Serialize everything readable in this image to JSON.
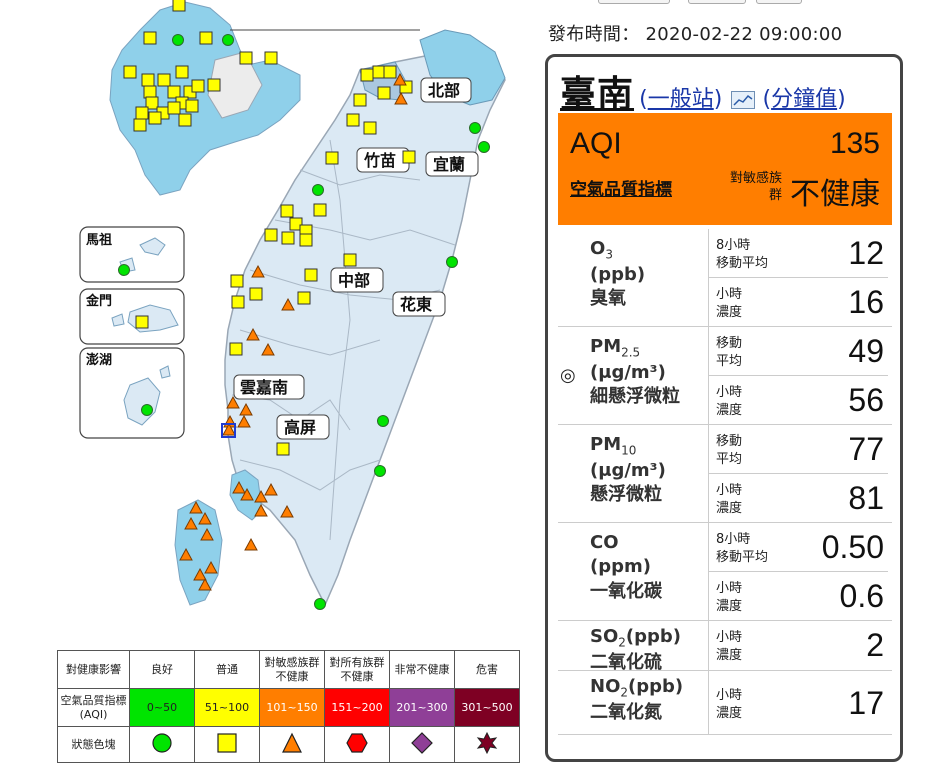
{
  "published": {
    "label": "發布時間：",
    "value": "2020-02-22 09:00:00"
  },
  "map": {
    "regions": [
      "北部",
      "竹苗",
      "宜蘭",
      "中部",
      "花東",
      "雲嘉南",
      "高屏"
    ],
    "insets": [
      "馬祖",
      "金門",
      "澎湖"
    ],
    "colors": {
      "land": "#dbe9f4",
      "county": "#aac8e0",
      "highlight": "#8fd0ea",
      "outline": "#9aa7b5"
    }
  },
  "legend": {
    "header": [
      "對健康影響",
      "良好",
      "普通",
      "對敏感族群不健康",
      "對所有族群不健康",
      "非常不健康",
      "危害"
    ],
    "aqi_label": "空氣品質指標(AQI)",
    "ranges": [
      "0~50",
      "51~100",
      "101~150",
      "151~200",
      "201~300",
      "301~500"
    ],
    "shape_label": "狀態色塊",
    "colors": [
      "#00e400",
      "#ffff00",
      "#ff7e00",
      "#ff0000",
      "#8f3f97",
      "#7e0023"
    ],
    "shapes": [
      "circle",
      "square",
      "triangle",
      "hexagon",
      "diamond",
      "star"
    ]
  },
  "station": {
    "name": "臺南",
    "type_link": "一般站",
    "minute_link": "分鐘值",
    "chart_icon": "chart-icon"
  },
  "aqi": {
    "label": "AQI",
    "value": "135",
    "index_link": "空氣品質指標",
    "sensitive": "對敏感族群",
    "status": "不健康",
    "color": "#ff7e00"
  },
  "pollutants": [
    {
      "name": "O",
      "sub": "3",
      "unit": "(ppb)",
      "zh": "臭氧",
      "rows": [
        {
          "label": "8小時 移動平均",
          "value": "12"
        },
        {
          "label": "小時 濃度",
          "value": "16"
        }
      ]
    },
    {
      "name": "PM",
      "sub": "2.5",
      "unit": "(μg/m³)",
      "zh": "細懸浮微粒",
      "marker": "◎",
      "rows": [
        {
          "label": "移動 平均",
          "value": "49"
        },
        {
          "label": "小時 濃度",
          "value": "56"
        }
      ]
    },
    {
      "name": "PM",
      "sub": "10",
      "unit": "(μg/m³)",
      "zh": "懸浮微粒",
      "rows": [
        {
          "label": "移動 平均",
          "value": "77"
        },
        {
          "label": "小時 濃度",
          "value": "81"
        }
      ]
    },
    {
      "name": "CO",
      "sub": "",
      "unit": "(ppm)",
      "zh": "一氧化碳",
      "rows": [
        {
          "label": "8小時 移動平均",
          "value": "0.50"
        },
        {
          "label": "小時 濃度",
          "value": "0.6"
        }
      ]
    },
    {
      "name": "SO",
      "sub": "2",
      "unit": "(ppb)",
      "zh": "二氧化硫",
      "rows": [
        {
          "label": "小時 濃度",
          "value": "2"
        }
      ]
    },
    {
      "name": "NO",
      "sub": "2",
      "unit": "(ppb)",
      "zh": "二氧化氮",
      "rows": [
        {
          "label": "小時 濃度",
          "value": "17"
        }
      ]
    }
  ]
}
